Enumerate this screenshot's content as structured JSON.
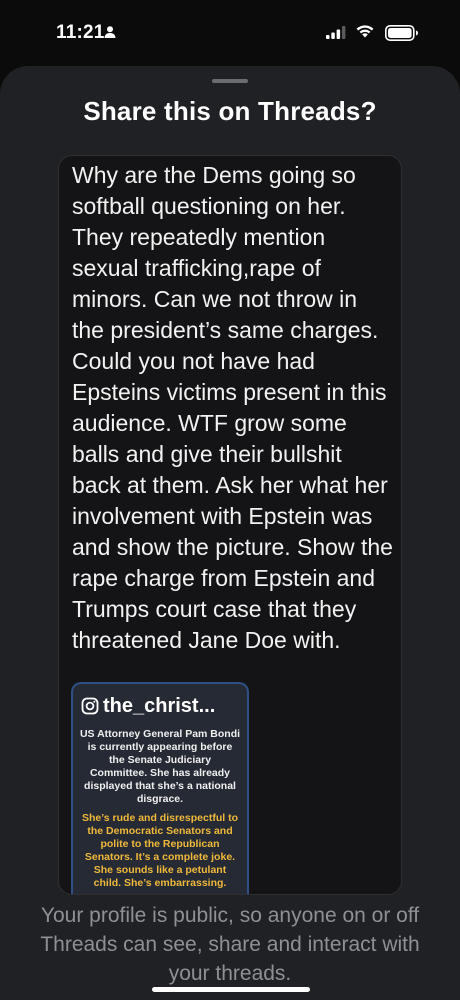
{
  "status_bar": {
    "time": "11:21"
  },
  "sheet": {
    "title": "Share this on Threads?",
    "post_text": "Why are the Dems going so softball questioning on her. They repeatedly mention sexual trafficking,rape of minors. Can we not throw in the president’s same charges. Could you not have had Epsteins victims present in this audience. WTF grow some balls and give their bullshit back at them. Ask her what her involvement with Epstein was and show the picture. Show the rape charge from Epstein and Trumps court case that they threatened Jane Doe with.",
    "embed": {
      "handle": "the_christ...",
      "text_white": "US Attorney General Pam Bondi is currently appearing before the Senate Judiciary Committee. She has already displayed that she’s a national disgrace.",
      "text_yellow": "She’s rude and disrespectful to the Democratic Senators and polite to the Republican Senators. It’s a complete joke. She sounds like a petulant child. She’s embarrassing."
    },
    "footer_note": "Your profile is public, so anyone on or off Threads can see, share and interact with your threads."
  },
  "colors": {
    "sheet_bg": "#202124",
    "card_bg": "#141416",
    "embed_border": "#2f4f86",
    "embed_accent_text": "#f0b93b",
    "muted_text": "#8e9096"
  },
  "icons": [
    "person-icon",
    "signal-icon",
    "wifi-icon",
    "battery-icon",
    "instagram-icon"
  ]
}
